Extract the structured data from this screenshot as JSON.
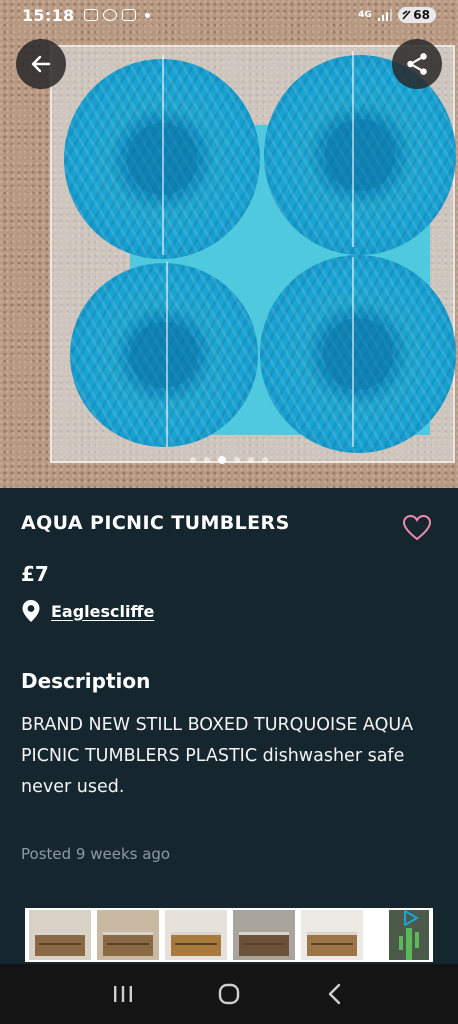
{
  "status_bar": {
    "time": "15:18",
    "network": "4G",
    "battery": "68"
  },
  "listing": {
    "title": "AQUA PICNIC TUMBLERS",
    "price": "£7",
    "location": "Eaglescliffe",
    "description_heading": "Description",
    "description": "BRAND NEW STILL BOXED  TURQUOISE AQUA PICNIC TUMBLERS PLASTIC dishwasher safe never used.",
    "posted": "Posted 9 weeks ago"
  },
  "gallery": {
    "total_images": 6,
    "active_index": 2
  },
  "colors": {
    "background": "#16262f",
    "heart_outline": "#f08ab0",
    "accent_ad": "#1aa6d6"
  },
  "icons": {
    "back": "arrow-left-icon",
    "share": "share-icon",
    "favorite": "heart-icon",
    "location": "location-pin-icon",
    "recents": "recents-icon",
    "home": "home-icon",
    "nav_back": "chevron-left-icon"
  }
}
